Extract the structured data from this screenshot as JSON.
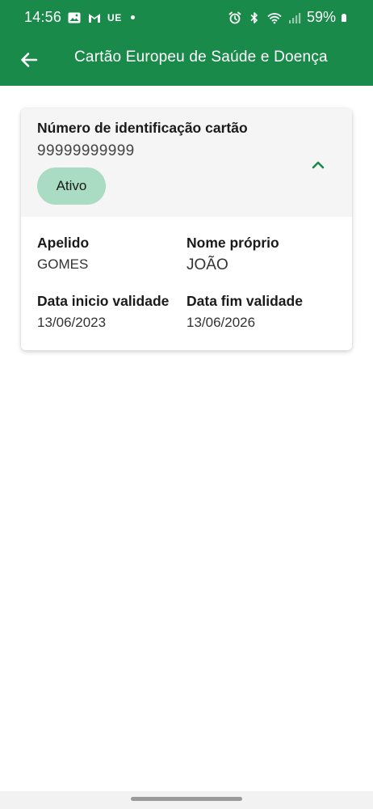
{
  "status_bar": {
    "time": "14:56",
    "carrier_tag": "UE",
    "battery_percent": "59%",
    "icons": [
      "gallery-icon",
      "gmail-icon",
      "alarm-icon",
      "bluetooth-icon",
      "wifi-icon",
      "signal-icon",
      "battery-icon"
    ]
  },
  "app_bar": {
    "title": "Cartão Europeu de Saúde e Doença",
    "back_icon": "arrow-left-icon"
  },
  "card": {
    "number_label": "Número de identificação cartão",
    "number_value": "99999999999",
    "status": "Ativo",
    "toggle_icon": "chevron-up-icon",
    "fields": [
      {
        "label": "Apelido",
        "value": "GOMES"
      },
      {
        "label": "Nome próprio",
        "value": "JOÃO"
      },
      {
        "label": "Data inicio validade",
        "value": "13/06/2023"
      },
      {
        "label": "Data fim validade",
        "value": "13/06/2026"
      }
    ]
  },
  "colors": {
    "primary": "#1a8a4b",
    "chip_bg": "#a9dcc2",
    "card_header_bg": "#f5f5f5",
    "chevron": "#1a8a4b"
  }
}
